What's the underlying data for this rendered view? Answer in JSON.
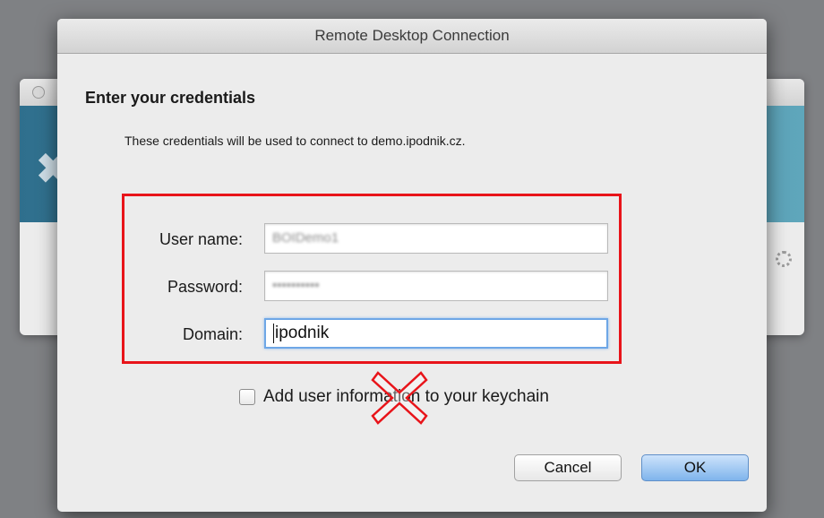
{
  "window": {
    "title": "Remote Desktop Connection"
  },
  "dialog": {
    "heading": "Enter your credentials",
    "description": "These credentials will be used to connect to demo.ipodnik.cz."
  },
  "fields": {
    "username": {
      "label": "User name:",
      "value": "BOIDemo1"
    },
    "password": {
      "label": "Password:",
      "value": "••••••••••"
    },
    "domain": {
      "label": "Domain:",
      "value": "ipodnik"
    }
  },
  "keychain": {
    "label": "Add user information to your keychain",
    "checked": false
  },
  "buttons": {
    "cancel": "Cancel",
    "ok": "OK"
  },
  "colors": {
    "highlight_box": "#e8141a",
    "ok_button": "#7fb4ec",
    "focus_ring": "#6ea7e6"
  },
  "icons": {
    "annotation": "red-x-icon",
    "spinner": "spinner-icon"
  }
}
